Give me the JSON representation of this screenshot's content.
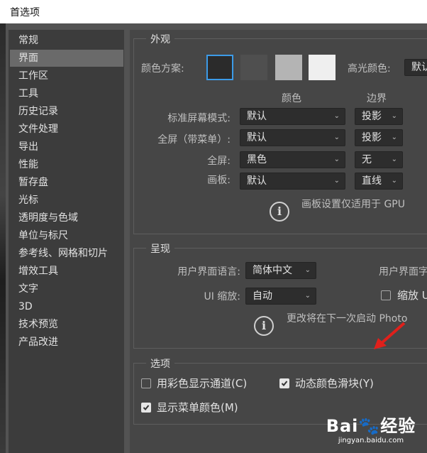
{
  "window": {
    "title": "首选项"
  },
  "sidebar": {
    "items": [
      {
        "label": "常规",
        "active": false
      },
      {
        "label": "界面",
        "active": true
      },
      {
        "label": "工作区",
        "active": false
      },
      {
        "label": "工具",
        "active": false
      },
      {
        "label": "历史记录",
        "active": false
      },
      {
        "label": "文件处理",
        "active": false
      },
      {
        "label": "导出",
        "active": false
      },
      {
        "label": "性能",
        "active": false
      },
      {
        "label": "暂存盘",
        "active": false
      },
      {
        "label": "光标",
        "active": false
      },
      {
        "label": "透明度与色域",
        "active": false
      },
      {
        "label": "单位与标尺",
        "active": false
      },
      {
        "label": "参考线、网格和切片",
        "active": false
      },
      {
        "label": "增效工具",
        "active": false
      },
      {
        "label": "文字",
        "active": false
      },
      {
        "label": "3D",
        "active": false
      },
      {
        "label": "技术预览",
        "active": false
      },
      {
        "label": "产品改进",
        "active": false
      }
    ]
  },
  "appearance": {
    "title": "外观",
    "color_scheme_label": "颜色方案:",
    "swatches": [
      "#2b2b2b",
      "#4f4f4f",
      "#b4b4b4",
      "#efefef"
    ],
    "selected_swatch": 0,
    "highlight_label": "高光颜色:",
    "highlight_value": "默认",
    "col_color": "颜色",
    "col_border": "边界",
    "rows": [
      {
        "label": "标准屏幕模式:",
        "color": "默认",
        "border": "投影"
      },
      {
        "label": "全屏（带菜单）:",
        "color": "默认",
        "border": "投影"
      },
      {
        "label": "全屏:",
        "color": "黑色",
        "border": "无"
      },
      {
        "label": "画板:",
        "color": "默认",
        "border": "直线"
      }
    ],
    "note": "画板设置仅适用于 GPU"
  },
  "presentation": {
    "title": "呈现",
    "language_label": "用户界面语言:",
    "language_value": "简体中文",
    "font_size_label": "用户界面字",
    "scale_label": "UI 缩放:",
    "scale_value": "自动",
    "scale_check_label": "缩放 U",
    "note": "更改将在下一次启动 Photo"
  },
  "options": {
    "title": "选项",
    "color_channels": {
      "label": "用彩色显示通道(C)",
      "checked": false
    },
    "dynamic_sliders": {
      "label": "动态颜色滑块(Y)",
      "checked": true
    },
    "menu_colors": {
      "label": "显示菜单颜色(M)",
      "checked": true
    }
  },
  "watermark": {
    "brand": "Bai🐾经验",
    "url": "jingyan.baidu.com"
  },
  "colors": {
    "arrow": "#e0201b",
    "info_icon": "i"
  }
}
